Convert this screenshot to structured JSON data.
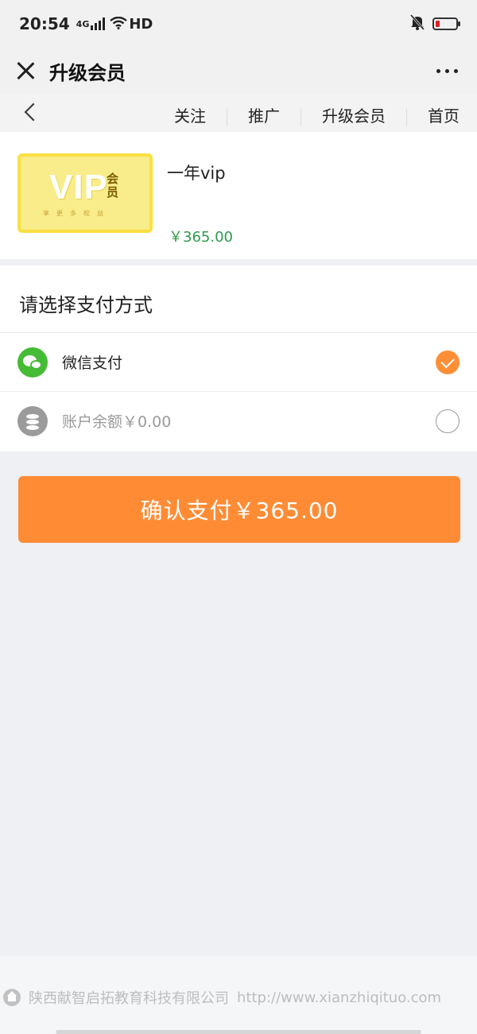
{
  "status_bar": {
    "time": "20:54",
    "network": "4G",
    "hd": "HD",
    "icons": [
      "signal-icon",
      "wifi-icon",
      "mute-bell-icon",
      "battery-icon"
    ],
    "battery_color": "#e02020"
  },
  "title_bar": {
    "title": "升级会员",
    "close_icon": "close-icon",
    "more_icon": "more-icon"
  },
  "site_nav": {
    "back_icon": "back-icon",
    "links": [
      "关注",
      "推广",
      "升级会员",
      "首页"
    ]
  },
  "product": {
    "card_text": "VIP",
    "card_member": "会员",
    "card_sub": "享更多权益",
    "name": "一年vip",
    "price": "￥365.00",
    "price_color": "#2e9a4a"
  },
  "payment": {
    "heading": "请选择支付方式",
    "methods": [
      {
        "label": "微信支付",
        "icon": "wechat-icon",
        "selected": true
      },
      {
        "label": "账户余额￥0.00",
        "icon": "coins-icon",
        "selected": false
      }
    ],
    "selected_color": "#ff8f36"
  },
  "confirm": {
    "label": "确认支付￥365.00",
    "color": "#ff8c35"
  },
  "footer": {
    "company": "陕西献智启拓教育科技有限公司",
    "url": "http://www.xianzhiqituo.com",
    "icon": "home-icon"
  }
}
